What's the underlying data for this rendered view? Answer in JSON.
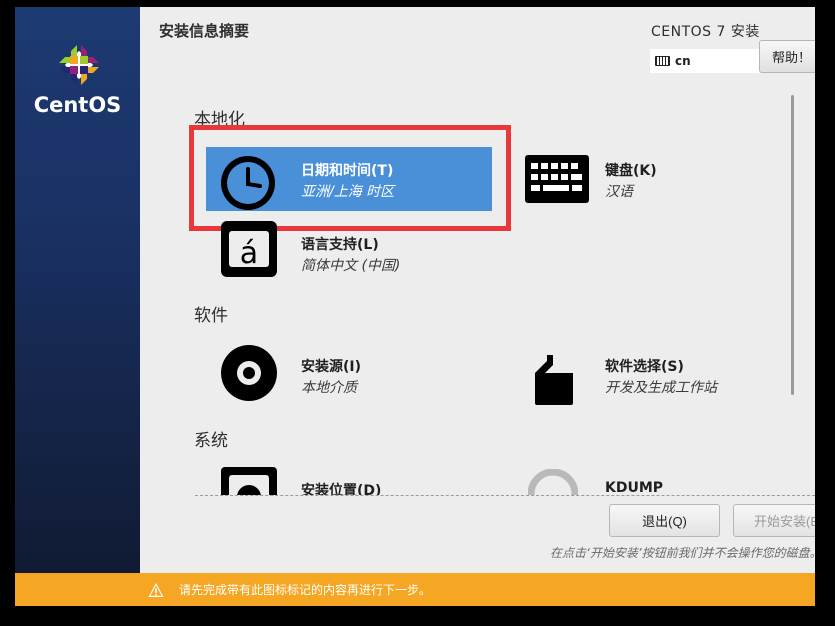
{
  "header": {
    "title": "安装信息摘要",
    "product": "CENTOS 7 安装",
    "keyboard_layout": "cn",
    "help_label": "帮助！"
  },
  "sidebar": {
    "brand": "CentOS"
  },
  "sections": [
    {
      "label": "本地化",
      "spokes": [
        {
          "name": "日期和时间(T)",
          "status": "亚洲/上海 时区",
          "icon": "clock-icon",
          "selected": true
        },
        {
          "name": "键盘(K)",
          "status": "汉语",
          "icon": "keyboard-icon"
        },
        {
          "name": "语言支持(L)",
          "status": "简体中文 (中国)",
          "icon": "language-icon"
        }
      ]
    },
    {
      "label": "软件",
      "spokes": [
        {
          "name": "安装源(I)",
          "status": "本地介质",
          "icon": "disc-icon"
        },
        {
          "name": "软件选择(S)",
          "status": "开发及生成工作站",
          "icon": "package-icon"
        }
      ]
    },
    {
      "label": "系统",
      "spokes": [
        {
          "name": "安装位置(D)",
          "status": "",
          "icon": "harddisk-icon"
        },
        {
          "name": "KDUMP",
          "status": "",
          "icon": "kdump-icon"
        }
      ]
    }
  ],
  "footer": {
    "quit_label": "退出(Q)",
    "begin_label": "开始安装(B)",
    "hint": "在点击‘开始安装’按钮前我们并不会操作您的磁盘。",
    "warning": "请先完成带有此图标标记的内容再进行下一步。"
  },
  "colors": {
    "selected": "#4a90d9",
    "warning_bar": "#f5a623",
    "highlight_box": "#e8383b",
    "sidebar": "#1a3266"
  }
}
